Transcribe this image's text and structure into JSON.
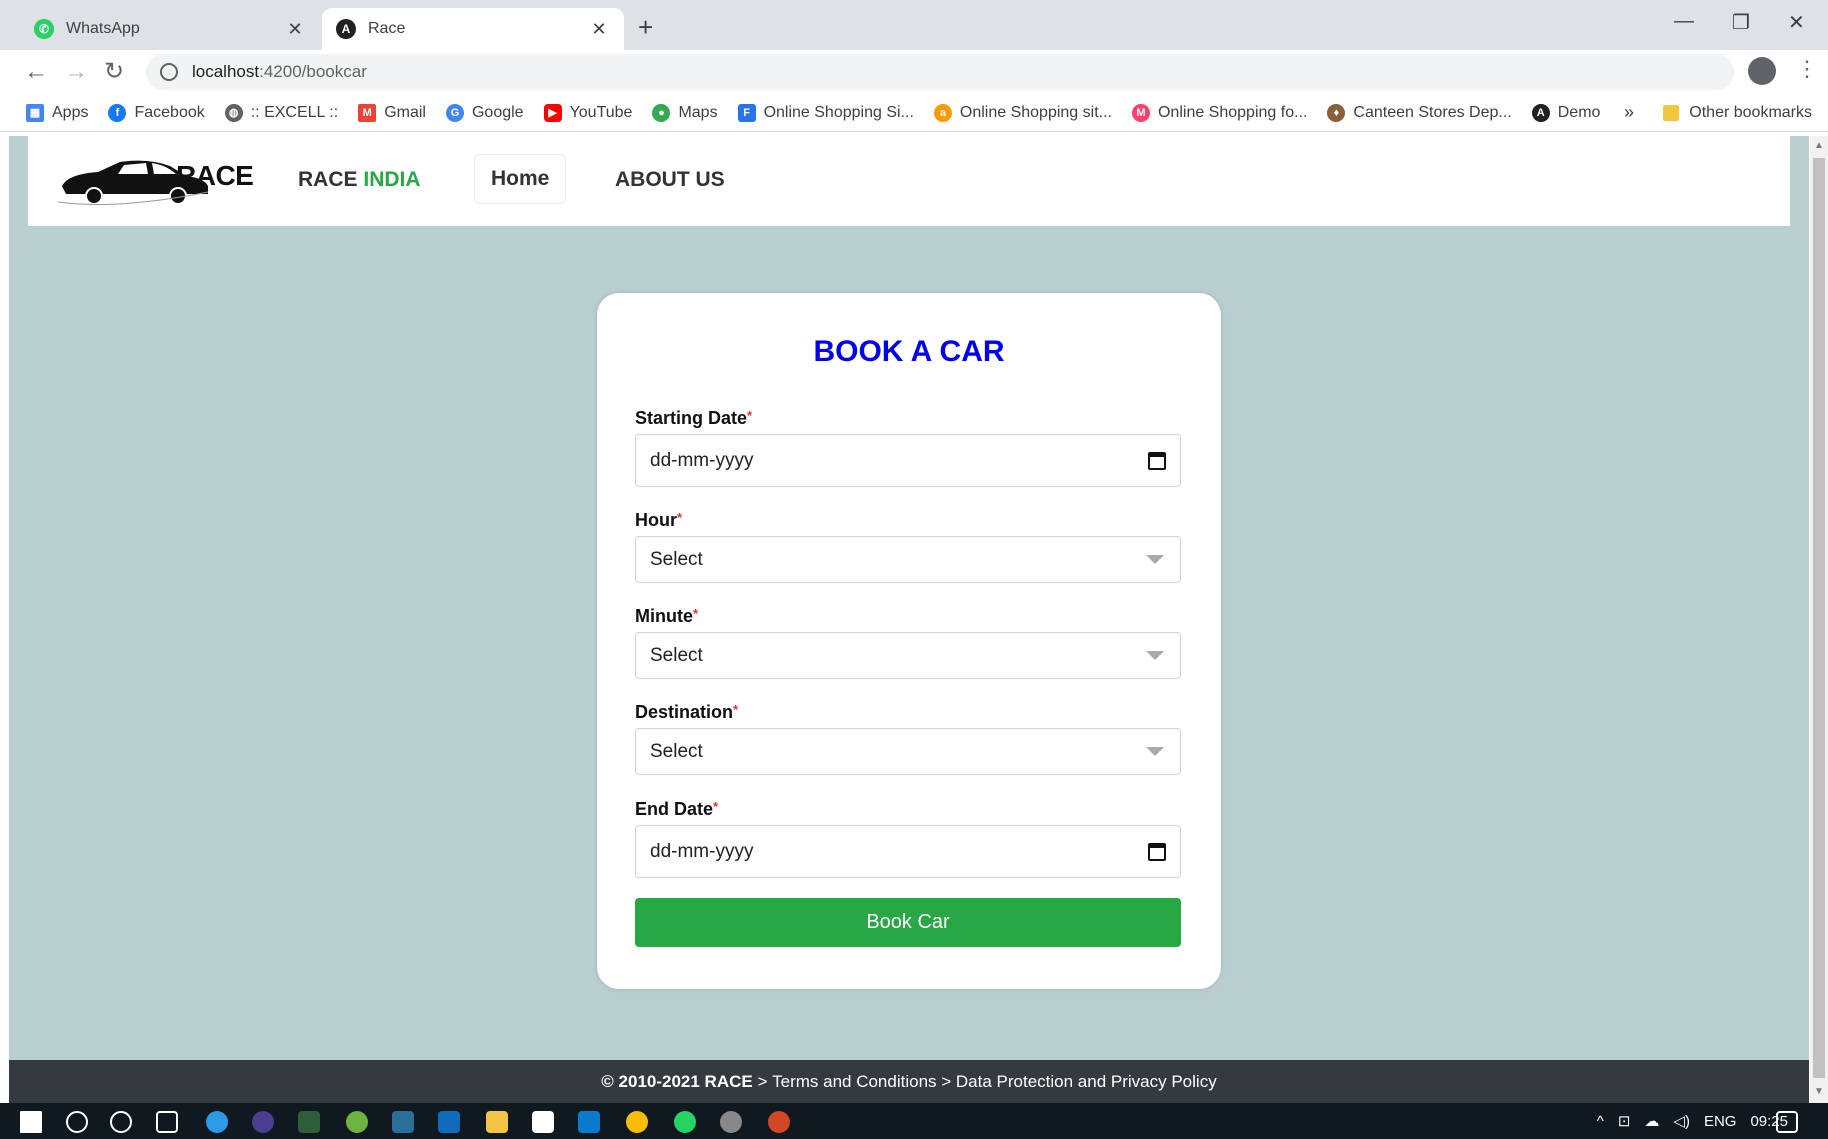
{
  "browser": {
    "tabs": [
      {
        "title": "WhatsApp",
        "icon": "whatsapp-icon",
        "active": false
      },
      {
        "title": "Race",
        "icon": "angular-icon",
        "active": true
      }
    ],
    "url_host": "localhost",
    "url_path": ":4200/bookcar",
    "bookmarks": [
      {
        "label": "Apps",
        "icon": "apps-grid-icon",
        "color": "#4285f4"
      },
      {
        "label": "Facebook",
        "icon": "facebook-icon",
        "color": "#1877f2"
      },
      {
        "label": ":: EXCELL ::",
        "icon": "globe-icon",
        "color": "#5f6368"
      },
      {
        "label": "Gmail",
        "icon": "gmail-icon",
        "color": "#ea4335"
      },
      {
        "label": "Google",
        "icon": "google-icon",
        "color": "#4285f4"
      },
      {
        "label": "YouTube",
        "icon": "youtube-icon",
        "color": "#ff0000"
      },
      {
        "label": "Maps",
        "icon": "maps-icon",
        "color": "#34a853"
      },
      {
        "label": "Online Shopping Si...",
        "icon": "flipkart-icon",
        "color": "#2874f0"
      },
      {
        "label": "Online Shopping sit...",
        "icon": "amazon-icon",
        "color": "#ff9900"
      },
      {
        "label": "Online Shopping fo...",
        "icon": "myntra-icon",
        "color": "#ff3f6c"
      },
      {
        "label": "Canteen Stores Dep...",
        "icon": "csd-icon",
        "color": "#8b5e3c"
      },
      {
        "label": "Demo",
        "icon": "angular-icon",
        "color": "#202124"
      }
    ],
    "more_bookmarks": "»",
    "other_bookmarks": "Other bookmarks"
  },
  "site": {
    "logo_text": "RACE",
    "brand_main": "RACE",
    "brand_accent": "INDIA",
    "nav_home": "Home",
    "nav_about": "ABOUT US"
  },
  "form": {
    "title": "BOOK A CAR",
    "required_mark": "*",
    "starting_date_label": "Starting Date",
    "starting_date_placeholder": "dd-mm-yyyy",
    "hour_label": "Hour",
    "hour_value": "Select",
    "minute_label": "Minute",
    "minute_value": "Select",
    "destination_label": "Destination",
    "destination_value": "Select",
    "end_date_label": "End Date",
    "end_date_placeholder": "dd-mm-yyyy",
    "submit_label": "Book Car"
  },
  "footer": {
    "copyright": "© 2010-2021 RACE",
    "sep1": " > ",
    "terms": "Terms and Conditions",
    "sep2": " > ",
    "privacy": "Data Protection and Privacy Policy"
  },
  "taskbar": {
    "language": "ENG",
    "time": "09:25"
  },
  "colors": {
    "page_bg": "#b9cfcf",
    "title_blue": "#0000ee",
    "accent_green": "#28a745",
    "footer_bg": "#343a40"
  }
}
